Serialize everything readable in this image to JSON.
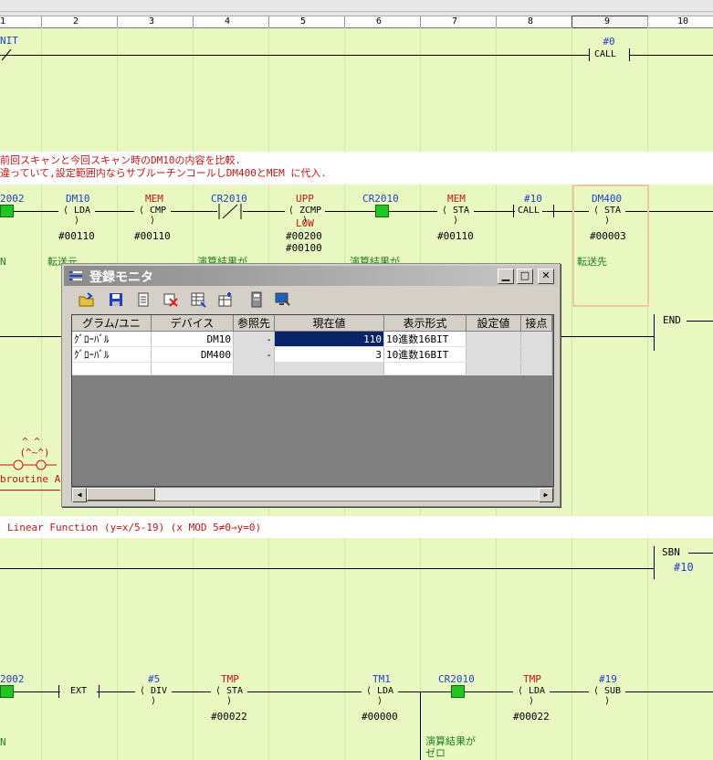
{
  "ruler": {
    "columns": [
      "1",
      "2",
      "3",
      "4",
      "5",
      "6",
      "7",
      "8",
      "9",
      "10"
    ],
    "selected_column": "9"
  },
  "rung1": {
    "contact_label": "NIT",
    "call_operand": "#0",
    "call_label": "CALL"
  },
  "comment1": {
    "line1": "前回スキャンと今回スキャン時のDM10の内容を比較.",
    "line2": "違っていて,設定範囲内ならサブルーチンコールしDM400とMEM に代入."
  },
  "rung2": {
    "c1": "2002",
    "c2_dev": "DM10",
    "c2_inst": "LDA",
    "c2_val": "#00110",
    "c3_dev": "MEM",
    "c3_inst": "CMP",
    "c3_val": "#00110",
    "c4_dev": "CR2010",
    "c5_dev": "UPP",
    "c5_inst": "ZCMP",
    "c5_low": "LOW",
    "c5_val1": "#00200",
    "c5_val2": "#00100",
    "c6_dev": "CR2010",
    "c7_dev": "MEM",
    "c7_inst": "STA",
    "c7_val": "#00110",
    "c8_dev": "#10",
    "c8_inst": "CALL",
    "c9_dev": "DM400",
    "c9_inst": "STA",
    "c9_val": "#00003",
    "n_label": "N",
    "c2_comment": "転送元",
    "c4_comment": "演算結果が",
    "c6_comment": "演算結果が",
    "c9_comment": "転送先"
  },
  "end_label": "END",
  "subroutine": {
    "face": "^ ^\n(^~^)",
    "label": "broutine A"
  },
  "comment2": "Linear Function (y=x/5-19)  (x MOD 5≠0⇒y=0)",
  "sbn": {
    "label": "SBN",
    "value": "#10"
  },
  "rung4": {
    "c1": "2002",
    "c2_inst": "EXT",
    "c3_dev": "#5",
    "c3_inst": "DIV",
    "c4_dev": "TMP",
    "c4_inst": "STA",
    "c4_val": "#00022",
    "c6_dev": "TM1",
    "c6_inst": "LDA",
    "c6_val": "#00000",
    "c7_dev": "CR2010",
    "c8_dev": "TMP",
    "c8_inst": "LDA",
    "c8_val": "#00022",
    "c9_dev": "#19",
    "c9_inst": "SUB",
    "n_label": "N",
    "c7_comment1": "演算結果が",
    "c7_comment2": "ゼロ"
  },
  "dialog": {
    "title": "登録モニタ",
    "headers": [
      "グラム/ユニ",
      "デバイス",
      "参照先",
      "現在値",
      "表示形式",
      "設定値",
      "接点"
    ],
    "rows": [
      {
        "program": "ｸﾞﾛｰﾊﾞﾙ",
        "device": "DM10",
        "ref": "-",
        "current": "110",
        "format": "10進数16BIT",
        "setting": "",
        "contact": ""
      },
      {
        "program": "ｸﾞﾛｰﾊﾞﾙ",
        "device": "DM400",
        "ref": "-",
        "current": "3",
        "format": "10進数16BIT",
        "setting": "",
        "contact": ""
      }
    ],
    "toolbar_icons": [
      "open-icon",
      "save-icon",
      "add-icon",
      "delete-icon",
      "table-icon",
      "table-insert-icon",
      "device-icon",
      "monitor-icon"
    ]
  },
  "colors": {
    "ladder_bg": "#e8f8c0",
    "device_blue": "#1f3fd0",
    "device_red": "#c81414",
    "contact_on": "#1ec81e",
    "selection": "#0a246a"
  }
}
